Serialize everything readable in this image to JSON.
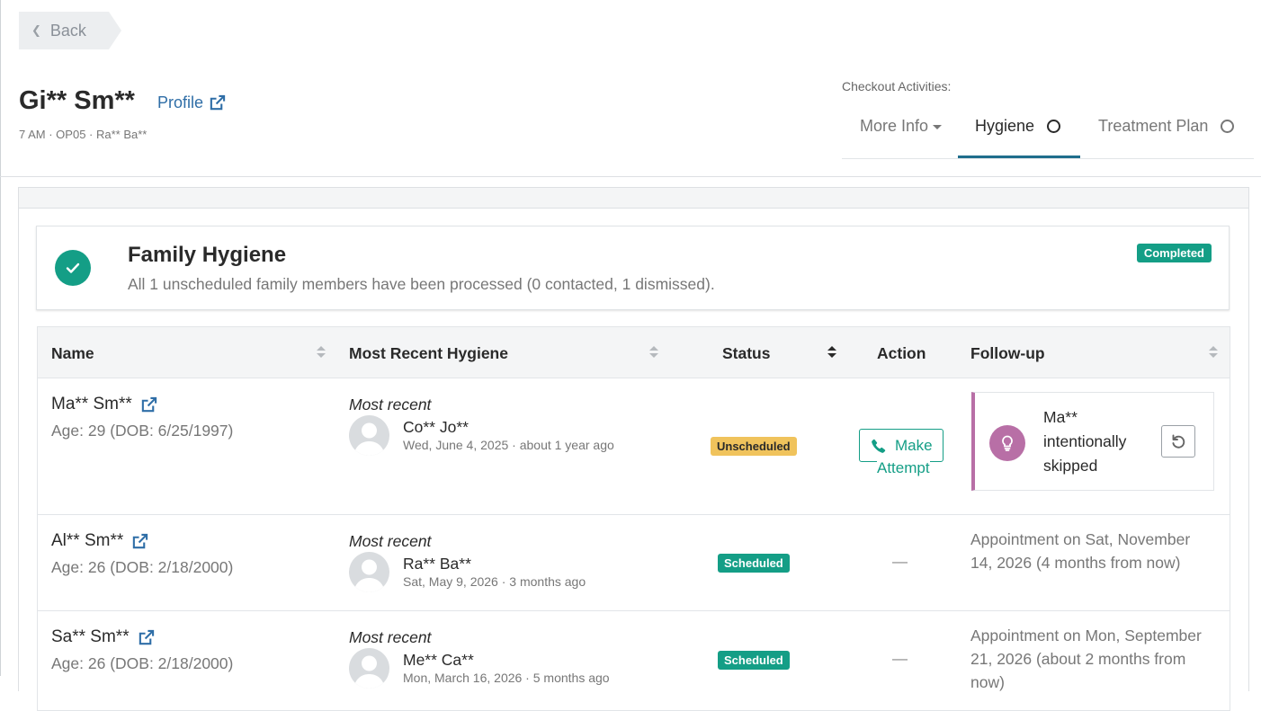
{
  "nav": {
    "back_label": "Back"
  },
  "patient": {
    "name": "Gi** Sm**",
    "profile_label": "Profile",
    "meta": "7 AM · OP05 · Ra** Ba**"
  },
  "checkout": {
    "label": "Checkout Activities:",
    "tabs": [
      {
        "label": "More Info",
        "active": false
      },
      {
        "label": "Hygiene",
        "active": true
      },
      {
        "label": "Treatment Plan",
        "active": false
      }
    ]
  },
  "summary": {
    "title": "Family Hygiene",
    "text": "All 1 unscheduled family members have been processed (0 contacted, 1 dismissed).",
    "badge": "Completed"
  },
  "table": {
    "columns": [
      "Name",
      "Most Recent Hygiene",
      "Status",
      "Action",
      "Follow-up"
    ],
    "rows": [
      {
        "name": "Ma** Sm**",
        "age": "Age: 29 (DOB: 6/25/1997)",
        "recent_label": "Most recent",
        "provider": "Co** Jo**",
        "date": "Wed, June 4, 2025 · about 1 year ago",
        "status": "Unscheduled",
        "action_line1": "Make",
        "action_line2": "Attempt",
        "followup_name": "Ma**",
        "followup_line2": "intentionally",
        "followup_line3": "skipped"
      },
      {
        "name": "Al** Sm**",
        "age": "Age: 26 (DOB: 2/18/2000)",
        "recent_label": "Most recent",
        "provider": "Ra** Ba**",
        "date": "Sat, May 9, 2026 · 3 months ago",
        "status": "Scheduled",
        "action": "—",
        "followup": "Appointment on Sat, November 14, 2026 (4 months from now)"
      },
      {
        "name": "Sa** Sm**",
        "age": "Age: 26 (DOB: 2/18/2000)",
        "recent_label": "Most recent",
        "provider": "Me** Ca**",
        "date": "Mon, March 16, 2026 · 5 months ago",
        "status": "Scheduled",
        "action": "—",
        "followup": "Appointment on Mon, September 21, 2026 (about 2 months from now)"
      }
    ]
  }
}
